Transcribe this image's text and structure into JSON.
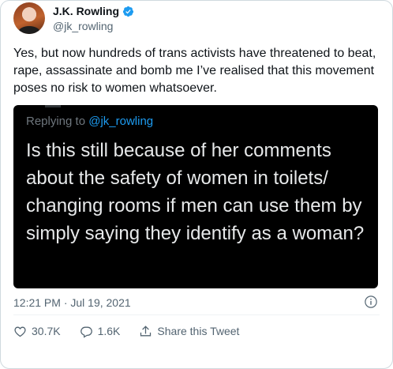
{
  "author": {
    "name": "J.K. Rowling",
    "handle": "@jk_rowling"
  },
  "tweet": {
    "text": "Yes, but now hundreds of trans activists have threatened to beat, rape, assassinate and bomb me I’ve realised that this movement poses no risk to women whatsoever.",
    "timestamp": "12:21 PM · Jul 19, 2021"
  },
  "quoted_image": {
    "replying_label": "Replying to ",
    "replying_handle": "@jk_rowling",
    "text": "Is this still because of her comments about the safety of women in toilets/ changing rooms if men can use them by simply saying they identify as a woman?"
  },
  "actions": {
    "likes": "30.7K",
    "replies": "1.6K",
    "share_label": "Share this Tweet"
  },
  "colors": {
    "verified": "#1d9bf0",
    "quote_background": "#000000",
    "mention": "#1d9bf0",
    "muted_text": "#536471"
  },
  "icons": [
    "verified-icon",
    "info-icon",
    "heart-icon",
    "reply-icon",
    "share-icon"
  ]
}
